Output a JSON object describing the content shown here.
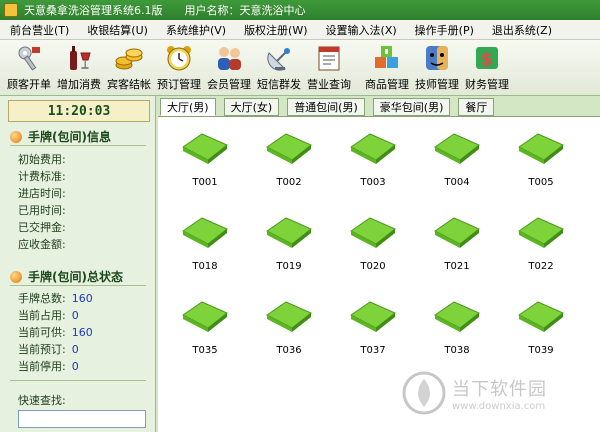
{
  "window": {
    "title": "天意桑拿洗浴管理系统6.1版",
    "user_label": "用户名称：天意洗浴中心"
  },
  "menu": [
    "前台营业(T)",
    "收银结算(U)",
    "系统维护(V)",
    "版权注册(W)",
    "设置输入法(X)",
    "操作手册(P)",
    "退出系统(Z)"
  ],
  "toolbar": [
    {
      "label": "顾客开单",
      "icon": "key-icon"
    },
    {
      "label": "增加消费",
      "icon": "wine-icon"
    },
    {
      "label": "宾客结帐",
      "icon": "coins-icon"
    },
    {
      "label": "预订管理",
      "icon": "alarm-clock-icon"
    },
    {
      "label": "会员管理",
      "icon": "members-icon"
    },
    {
      "label": "短信群发",
      "icon": "satellite-icon"
    },
    {
      "label": "营业查询",
      "icon": "report-icon"
    },
    {
      "label": "商品管理",
      "icon": "boxes-icon"
    },
    {
      "label": "技师管理",
      "icon": "technician-icon"
    },
    {
      "label": "财务管理",
      "icon": "finance-icon"
    }
  ],
  "clock": "11:20:03",
  "info": {
    "title": "手牌(包间)信息",
    "fields": [
      "初始费用:",
      "计费标准:",
      "进店时间:",
      "已用时间:",
      "已交押金:",
      "应收金额:"
    ]
  },
  "status": {
    "title": "手牌(包间)总状态",
    "rows": [
      {
        "label": "手牌总数:",
        "value": "160"
      },
      {
        "label": "当前占用:",
        "value": "0"
      },
      {
        "label": "当前可供:",
        "value": "160"
      },
      {
        "label": "当前预订:",
        "value": "0"
      },
      {
        "label": "当前停用:",
        "value": "0"
      }
    ]
  },
  "quick_search": {
    "label": "快速查找:",
    "value": ""
  },
  "tabs": [
    "大厅(男)",
    "大厅(女)",
    "普通包间(男)",
    "豪华包间(男)",
    "餐厅"
  ],
  "rooms": [
    [
      "T001",
      "T002",
      "T003",
      "T004",
      "T005"
    ],
    [
      "T018",
      "T019",
      "T020",
      "T021",
      "T022"
    ],
    [
      "T035",
      "T036",
      "T037",
      "T038",
      "T039"
    ]
  ],
  "watermark": {
    "brand": "当下软件园",
    "url": "www.downxia.com"
  },
  "colors": {
    "accent": "#2f7f2c",
    "room": "#7ed33a",
    "value": "#1b39c5"
  }
}
